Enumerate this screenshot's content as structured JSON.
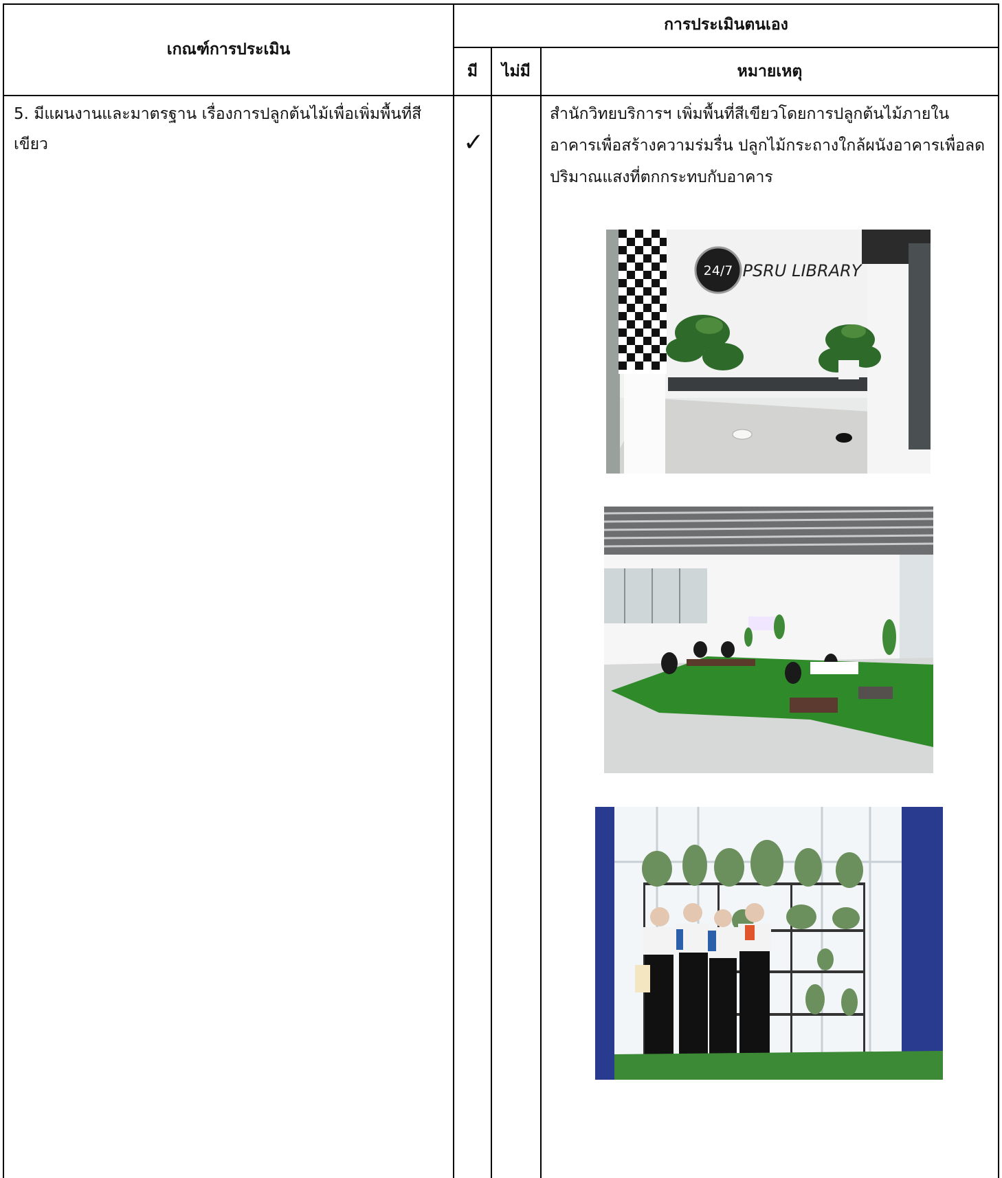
{
  "header": {
    "criteria_label": "เกณฑ์การประเมิน",
    "self_assessment_label": "การประเมินตนเอง",
    "yes_label": "มี",
    "no_label": "ไม่มี",
    "remark_label": "หมายเหตุ"
  },
  "row": {
    "criterion": "5. มีแผนงานและมาตรฐาน เรื่องการปลูกต้นไม้เพื่อเพิ่มพื้นที่สีเขียว",
    "yes_mark": "✓",
    "remark_lines": [
      "สำนักวิทยบริการฯ  เพิ่มพื้นที่สีเขียวโดยการปลูกต้นไม้ภายใน",
      "อาคารเพื่อสร้างความร่มรื่น ปลูกไม้กระถางใกล้ผนังอาคารเพื่อลด",
      "ปริมาณแสงที่ตกกระทบกับอาคาร"
    ]
  },
  "photos": {
    "photo1": {
      "badge": "24/7",
      "sign": "PSRU LIBRARY",
      "description": "library-corner-with-monstera-plants"
    },
    "photo2": {
      "description": "artificial-grass-reading-area-with-students"
    },
    "photo3": {
      "description": "students-posing-before-plant-shelves"
    }
  },
  "colors": {
    "border": "#000000",
    "grass": "#2f8a2a",
    "blue_wall": "#283b8e"
  }
}
